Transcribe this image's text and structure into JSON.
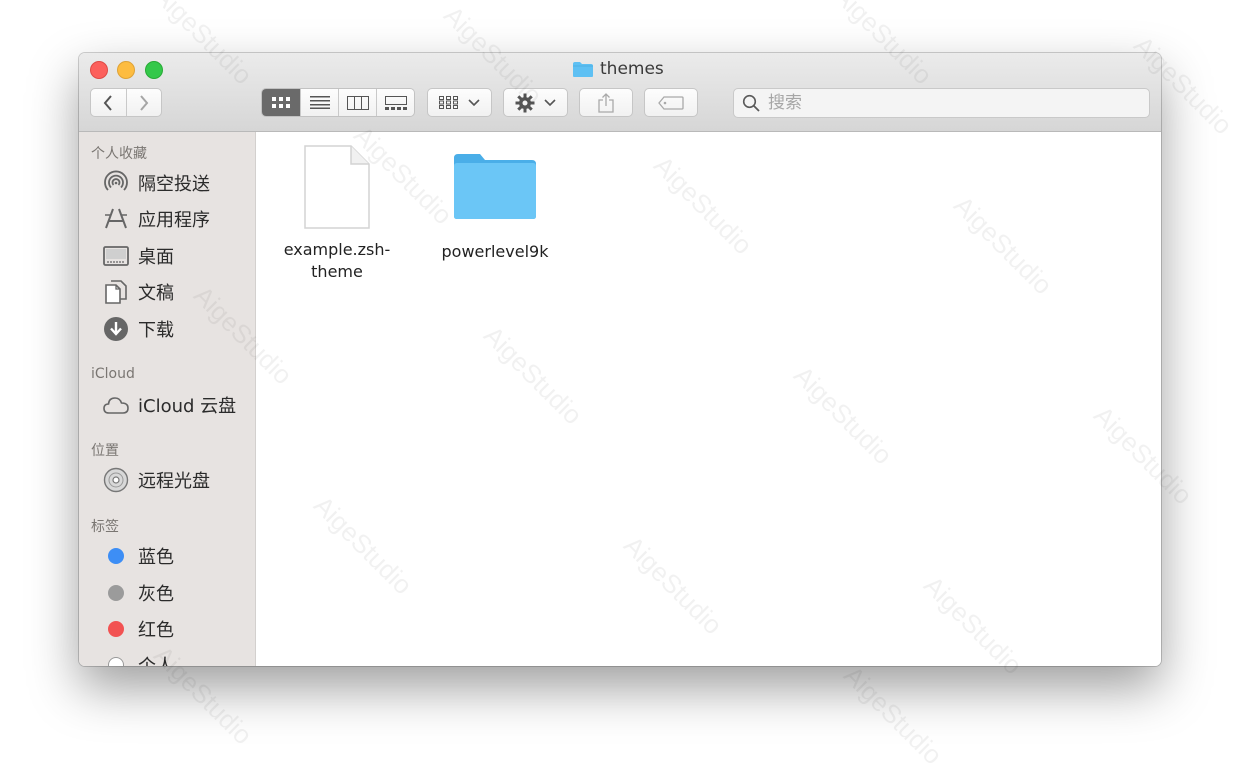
{
  "window": {
    "title": "themes"
  },
  "toolbar": {
    "back_icon": "chevron-left-icon",
    "forward_icon": "chevron-right-icon",
    "view_modes": [
      "icon-view-icon",
      "list-view-icon",
      "column-view-icon",
      "gallery-view-icon"
    ],
    "active_view": "icon-view-icon",
    "group_icon": "group-grid-icon",
    "action_icon": "gear-icon",
    "share_icon": "share-icon",
    "tag_icon": "tag-icon"
  },
  "search": {
    "placeholder": "搜索",
    "value": ""
  },
  "sidebar": {
    "favorites": {
      "title": "个人收藏",
      "items": [
        {
          "label": "隔空投送",
          "icon": "airdrop-icon"
        },
        {
          "label": "应用程序",
          "icon": "applications-icon"
        },
        {
          "label": "桌面",
          "icon": "desktop-icon"
        },
        {
          "label": "文稿",
          "icon": "documents-icon"
        },
        {
          "label": "下载",
          "icon": "downloads-icon"
        }
      ]
    },
    "icloud": {
      "title": "iCloud",
      "items": [
        {
          "label": "iCloud 云盘",
          "icon": "cloud-icon"
        }
      ]
    },
    "locations": {
      "title": "位置",
      "items": [
        {
          "label": "远程光盘",
          "icon": "disc-icon"
        }
      ]
    },
    "tags": {
      "title": "标签",
      "items": [
        {
          "label": "蓝色",
          "color": "#3d8ef5"
        },
        {
          "label": "灰色",
          "color": "#9b9b9b"
        },
        {
          "label": "红色",
          "color": "#f25252"
        },
        {
          "label": "个人",
          "color": "#ffffff"
        }
      ]
    }
  },
  "files": [
    {
      "name_line1": "example.zsh-",
      "name_line2": "theme",
      "icon": "document-icon"
    },
    {
      "name_line1": "powerlevel9k",
      "name_line2": "",
      "icon": "folder-icon"
    }
  ],
  "colors": {
    "folder": "#5ec0f3",
    "sidebar_bg": "#e7e3e1",
    "titlebar": "#e0e0e0"
  },
  "watermark": "AigeStudio"
}
